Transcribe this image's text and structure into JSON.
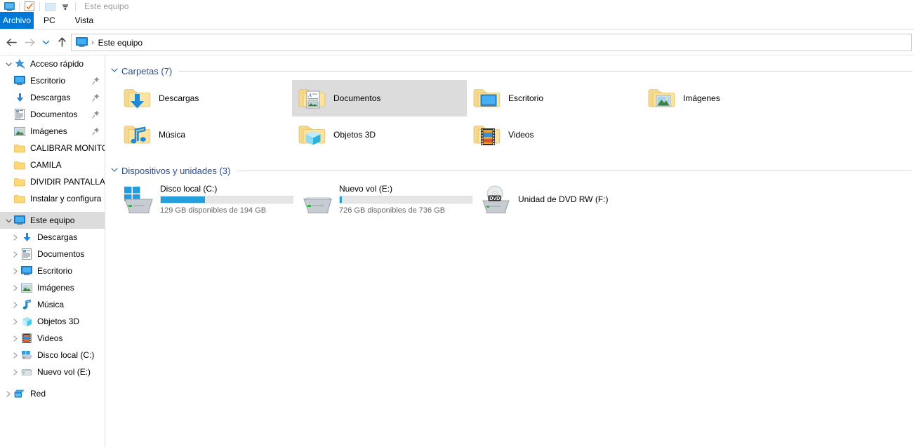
{
  "window": {
    "title": "Este equipo",
    "quick_access_toolbar": [
      {
        "name": "explorer-icon",
        "glyph": "monitor"
      },
      {
        "name": "properties-icon",
        "glyph": "checkbox"
      },
      {
        "name": "new-folder-icon",
        "glyph": "folder"
      },
      {
        "name": "customize-qat-icon",
        "glyph": "chevron-down"
      }
    ]
  },
  "ribbon": {
    "tabs": [
      {
        "label": "Archivo",
        "active": true
      },
      {
        "label": "PC",
        "active": false
      },
      {
        "label": "Vista",
        "active": false
      }
    ]
  },
  "navbar": {
    "back_label": "←",
    "forward_label": "→",
    "recent_label": "⌄",
    "up_label": "↑",
    "breadcrumb": {
      "root_icon": "this-pc-icon",
      "separator": "›",
      "path": "Este equipo"
    }
  },
  "sidebar": {
    "quick_access": {
      "label": "Acceso rápido",
      "icon": "star-pin-icon",
      "expanded": true,
      "items": [
        {
          "label": "Escritorio",
          "icon": "desktop-icon",
          "pinned": true
        },
        {
          "label": "Descargas",
          "icon": "downloads-icon",
          "pinned": true
        },
        {
          "label": "Documentos",
          "icon": "documents-icon",
          "pinned": true
        },
        {
          "label": "Imágenes",
          "icon": "pictures-icon",
          "pinned": true
        },
        {
          "label": "CALIBRAR MONITO",
          "icon": "folder-icon",
          "pinned": false
        },
        {
          "label": "CAMILA",
          "icon": "folder-icon",
          "pinned": false
        },
        {
          "label": "DIVIDIR PANTALLA",
          "icon": "folder-icon",
          "pinned": false
        },
        {
          "label": "Instalar y configura",
          "icon": "folder-icon",
          "pinned": false
        }
      ]
    },
    "this_pc": {
      "label": "Este equipo",
      "icon": "this-pc-icon",
      "expanded": true,
      "selected": true,
      "items": [
        {
          "label": "Descargas",
          "icon": "downloads-icon"
        },
        {
          "label": "Documentos",
          "icon": "documents-icon"
        },
        {
          "label": "Escritorio",
          "icon": "desktop-icon"
        },
        {
          "label": "Imágenes",
          "icon": "pictures-icon"
        },
        {
          "label": "Música",
          "icon": "music-icon"
        },
        {
          "label": "Objetos 3D",
          "icon": "objects3d-icon"
        },
        {
          "label": "Videos",
          "icon": "videos-icon"
        },
        {
          "label": "Disco local (C:)",
          "icon": "hdd-windows-icon"
        },
        {
          "label": "Nuevo vol (E:)",
          "icon": "hdd-icon"
        }
      ]
    },
    "network": {
      "label": "Red",
      "icon": "network-icon"
    }
  },
  "main": {
    "groups": [
      {
        "title": "Carpetas (7)",
        "expanded": true,
        "items": [
          {
            "label": "Descargas",
            "icon": "folder-downloads-icon",
            "selected": false
          },
          {
            "label": "Documentos",
            "icon": "folder-documents-icon",
            "selected": true
          },
          {
            "label": "Escritorio",
            "icon": "folder-desktop-icon",
            "selected": false
          },
          {
            "label": "Imágenes",
            "icon": "folder-pictures-icon",
            "selected": false
          },
          {
            "label": "Música",
            "icon": "folder-music-icon",
            "selected": false
          },
          {
            "label": "Objetos 3D",
            "icon": "folder-objects3d-icon",
            "selected": false
          },
          {
            "label": "Videos",
            "icon": "folder-videos-icon",
            "selected": false
          }
        ]
      },
      {
        "title": "Dispositivos y unidades (3)",
        "expanded": true,
        "drives": [
          {
            "name": "Disco local (C:)",
            "icon": "hdd-windows-icon",
            "has_bar": true,
            "used_percent": 33.5,
            "bar_color": "#26a0da",
            "sub": "129 GB disponibles de 194 GB"
          },
          {
            "name": "Nuevo vol (E:)",
            "icon": "hdd-icon",
            "has_bar": true,
            "used_percent": 1.4,
            "bar_color": "#26a0da",
            "sub": "726 GB disponibles de 736 GB"
          },
          {
            "name": "Unidad de DVD RW (F:)",
            "icon": "dvd-drive-icon",
            "has_bar": false,
            "used_percent": 0,
            "bar_color": "#26a0da",
            "sub": ""
          }
        ]
      }
    ]
  },
  "colors": {
    "accent": "#0078d7",
    "group_title": "#2a4d8f",
    "selection": "#dcdcdc",
    "bar_fill": "#26a0da",
    "folder": "#fbd97d"
  }
}
